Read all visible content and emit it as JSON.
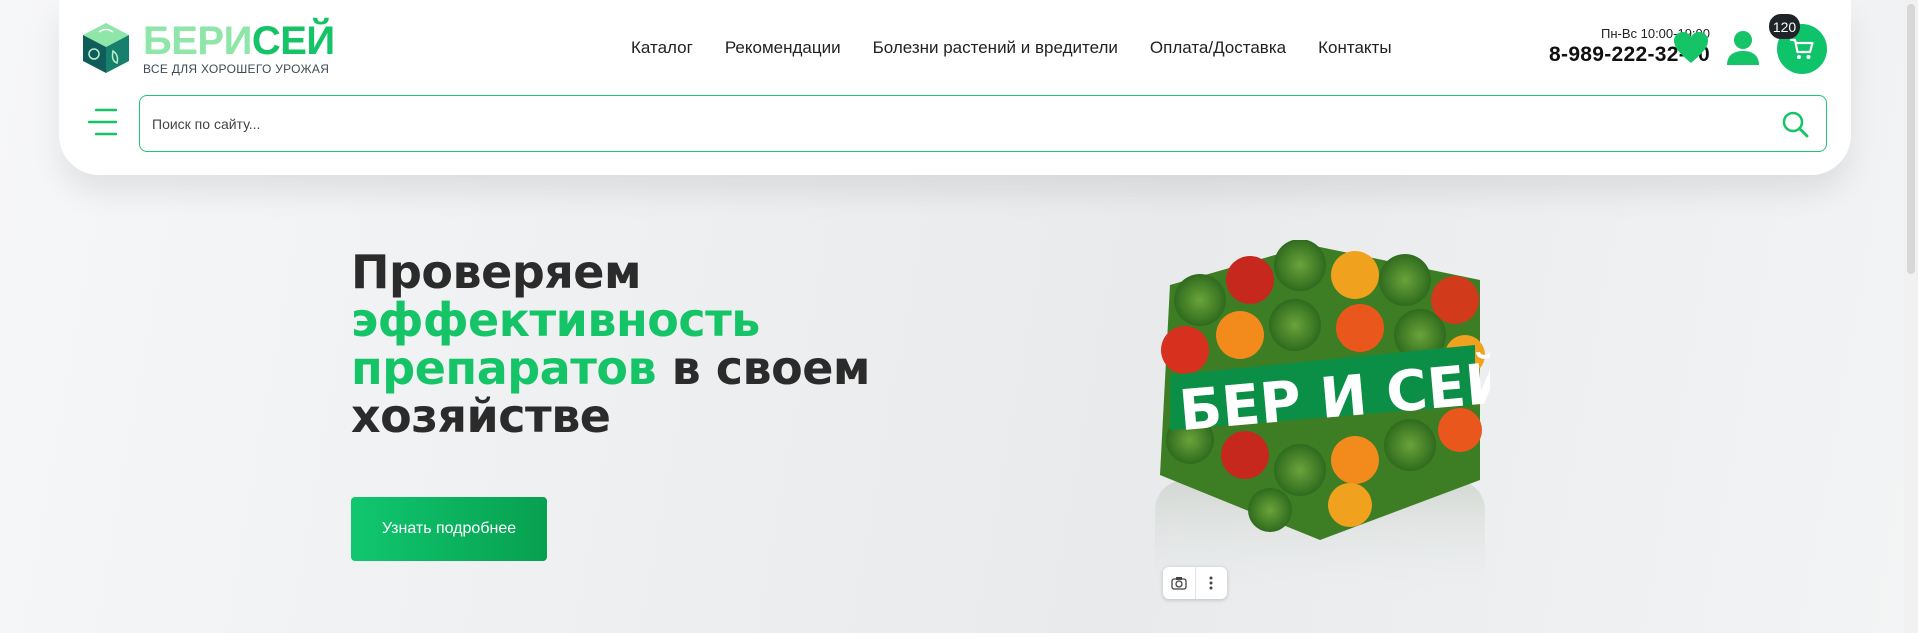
{
  "logo": {
    "brand_part1": "БЕРИ",
    "brand_part2": "СЕЙ",
    "tagline": "ВСЕ ДЛЯ ХОРОШЕГО УРОЖАЯ"
  },
  "nav": {
    "items": [
      {
        "label": "Каталог"
      },
      {
        "label": "Рекомендации"
      },
      {
        "label": "Болезни растений и вредители"
      },
      {
        "label": "Оплата/Доставка"
      },
      {
        "label": "Контакты"
      }
    ]
  },
  "contact": {
    "hours": "Пн-Вс 10:00-19:00",
    "phone": "8-989-222-32-70"
  },
  "cart": {
    "count": "120"
  },
  "icons": {
    "menu": "menu-icon",
    "heart": "heart-icon",
    "user": "user-icon",
    "cart": "cart-icon",
    "search": "search-icon",
    "camera": "camera-icon",
    "more": "more-vertical-icon"
  },
  "search": {
    "placeholder": "Поиск по сайту..."
  },
  "hero": {
    "title_line1": "Проверяем",
    "title_accent": "эффективность препаратов",
    "title_rest_1": "в своем",
    "title_rest_2": "хозяйстве",
    "cta_label": "Узнать подробнее",
    "image_text": "БЕР И СЕЙ"
  },
  "colors": {
    "accent": "#14c466",
    "accent_light": "#8ee6a8",
    "text_dark": "#2b2b2b",
    "badge_bg": "#1e2428"
  }
}
